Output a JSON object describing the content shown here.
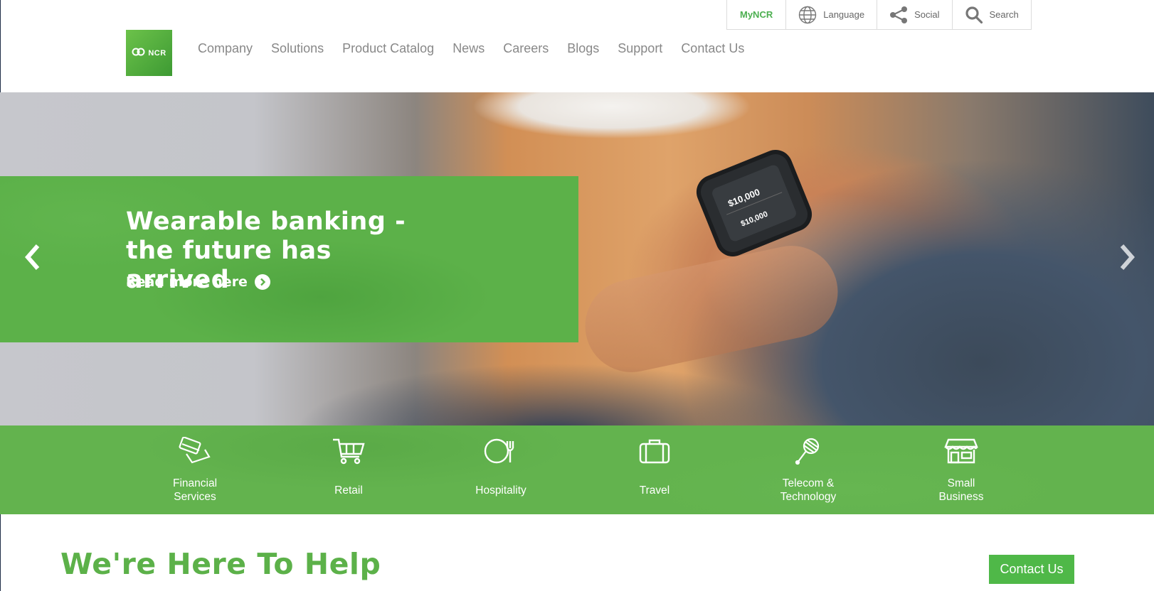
{
  "utility": {
    "mync": "MyNCR",
    "language": "Language",
    "social": "Social",
    "search": "Search"
  },
  "logo": {
    "text": "NCR"
  },
  "nav": {
    "items": [
      "Company",
      "Solutions",
      "Product Catalog",
      "News",
      "Careers",
      "Blogs",
      "Support",
      "Contact Us"
    ]
  },
  "hero": {
    "headline_line1": "Wearable banking -",
    "headline_line2": "the future has arrived",
    "read_more": "Read more here",
    "watch_amount": "$10,000"
  },
  "industries": [
    {
      "label": "Financial\nServices",
      "icon": "credit-card-icon"
    },
    {
      "label": "Retail",
      "icon": "shopping-cart-icon"
    },
    {
      "label": "Hospitality",
      "icon": "plate-fork-icon"
    },
    {
      "label": "Travel",
      "icon": "suitcase-icon"
    },
    {
      "label": "Telecom &\nTechnology",
      "icon": "satellite-icon"
    },
    {
      "label": "Small\nBusiness",
      "icon": "storefront-icon"
    }
  ],
  "help": {
    "heading": "We're Here To Help",
    "contact_button": "Contact Us"
  },
  "colors": {
    "brand_green": "#5cb149",
    "button_green": "#4fb848",
    "nav_gray": "#888888"
  }
}
